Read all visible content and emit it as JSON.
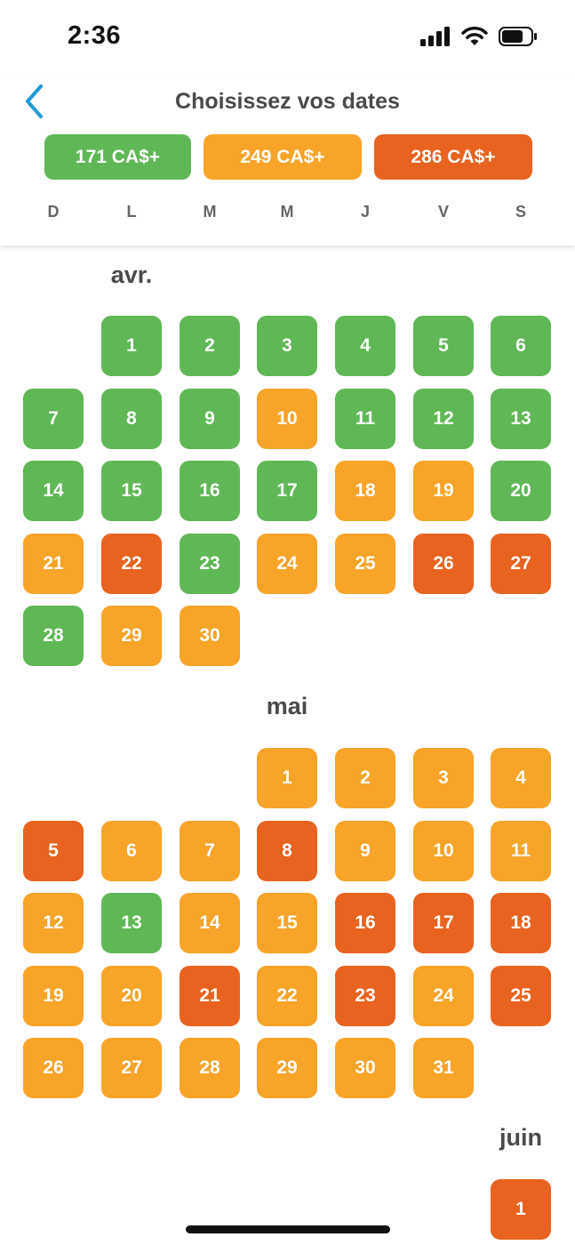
{
  "status_bar": {
    "time": "2:36"
  },
  "header": {
    "title": "Choisissez vos dates"
  },
  "colors": {
    "green": "#5fb855",
    "orange": "#f7a429",
    "red": "#e8631f",
    "back": "#1f9bd7"
  },
  "legend": [
    {
      "label": "171 CA$+",
      "level": "green"
    },
    {
      "label": "249 CA$+",
      "level": "orange"
    },
    {
      "label": "286 CA$+",
      "level": "red"
    }
  ],
  "weekdays": [
    "D",
    "L",
    "M",
    "M",
    "J",
    "V",
    "S"
  ],
  "months": [
    {
      "name": "avr.",
      "first_weekday": 1,
      "levels": [
        "green",
        "green",
        "green",
        "green",
        "green",
        "green",
        "green",
        "green",
        "green",
        "orange",
        "green",
        "green",
        "green",
        "green",
        "green",
        "green",
        "green",
        "orange",
        "orange",
        "green",
        "orange",
        "red",
        "green",
        "orange",
        "orange",
        "red",
        "red",
        "green",
        "orange",
        "orange"
      ]
    },
    {
      "name": "mai",
      "first_weekday": 3,
      "levels": [
        "orange",
        "orange",
        "orange",
        "orange",
        "red",
        "orange",
        "orange",
        "red",
        "orange",
        "orange",
        "orange",
        "orange",
        "green",
        "orange",
        "orange",
        "red",
        "red",
        "red",
        "orange",
        "orange",
        "red",
        "orange",
        "red",
        "orange",
        "red",
        "orange",
        "orange",
        "orange",
        "orange",
        "orange",
        "orange"
      ]
    },
    {
      "name": "juin",
      "first_weekday": 6,
      "levels": [
        "red"
      ]
    }
  ]
}
